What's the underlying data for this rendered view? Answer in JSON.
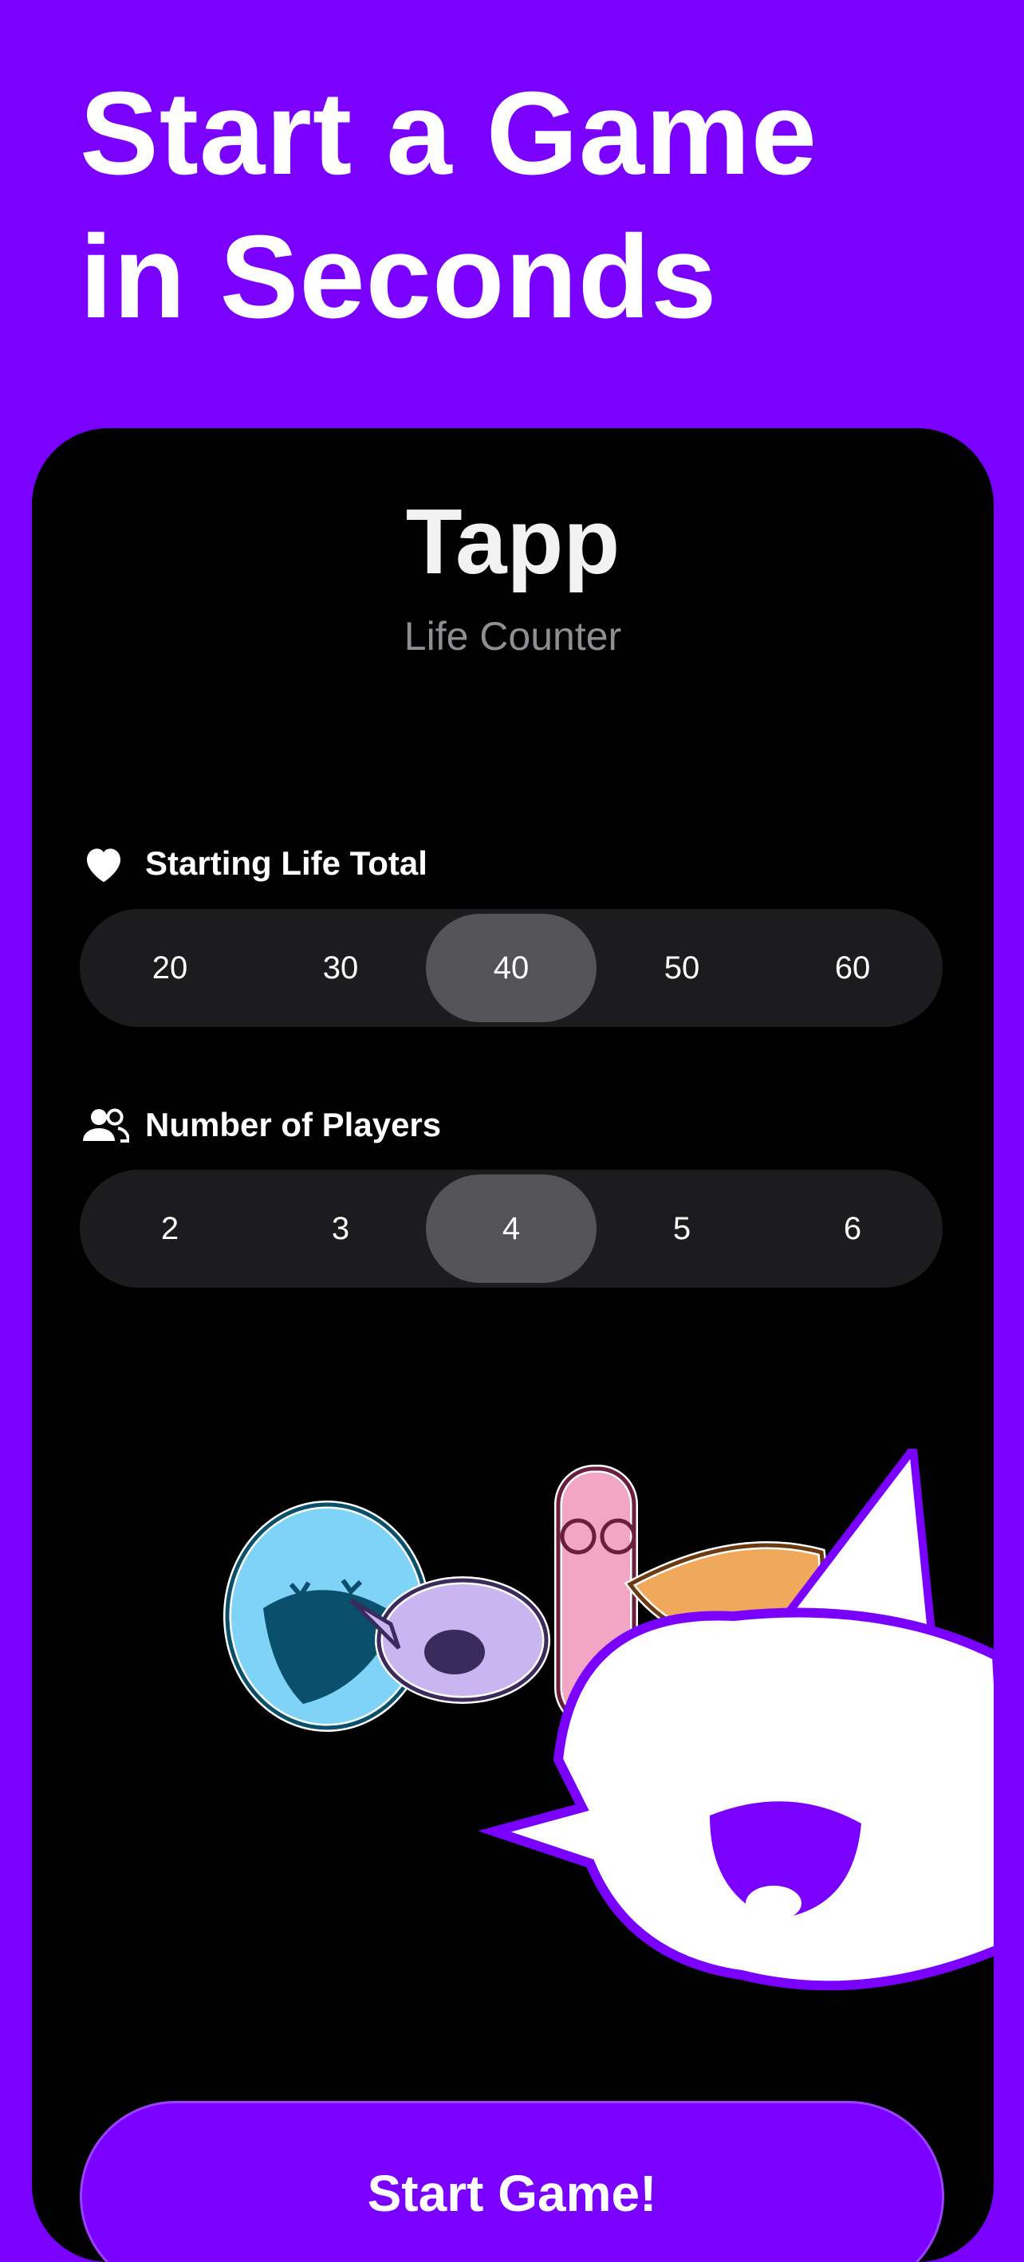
{
  "headline": {
    "line1": "Start a Game",
    "line2": "in Seconds"
  },
  "app": {
    "title": "Tapp",
    "subtitle": "Life Counter"
  },
  "life_total": {
    "label": "Starting Life Total",
    "icon": "heart-icon",
    "options": [
      "20",
      "30",
      "40",
      "50",
      "60"
    ],
    "selected": "40"
  },
  "players": {
    "label": "Number of Players",
    "icon": "people-icon",
    "options": [
      "2",
      "3",
      "4",
      "5",
      "6"
    ],
    "selected": "4"
  },
  "start_button": {
    "label": "Start Game!"
  },
  "colors": {
    "background": "#7a00ff",
    "card": "#000000",
    "segment_bg": "#1c1c1e",
    "segment_active": "#545458",
    "subtitle": "#8e8e93"
  }
}
